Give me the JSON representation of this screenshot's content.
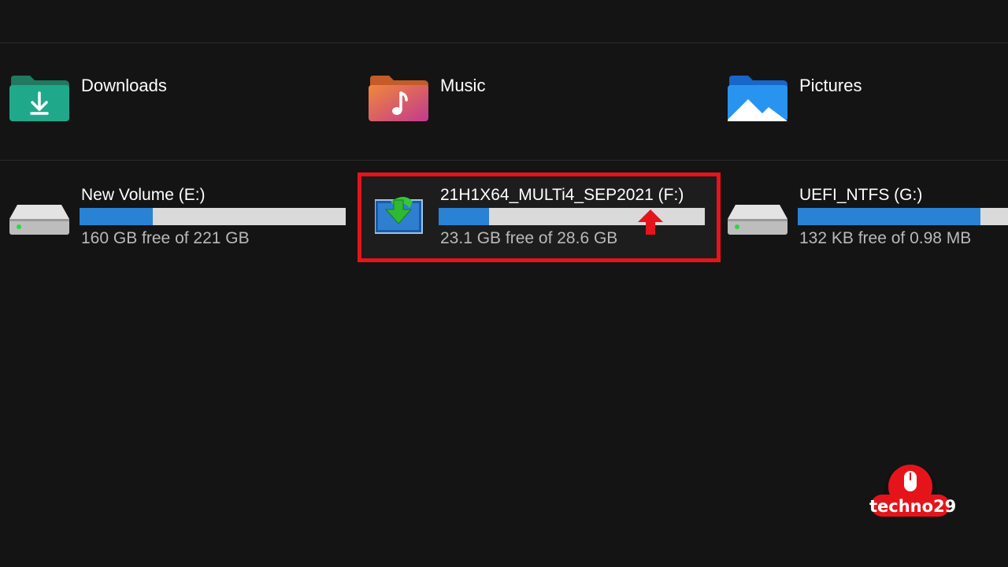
{
  "folders": [
    {
      "label": "Downloads",
      "icon": "downloads-folder-icon"
    },
    {
      "label": "Music",
      "icon": "music-folder-icon"
    },
    {
      "label": "Pictures",
      "icon": "pictures-folder-icon"
    }
  ],
  "drives": [
    {
      "name": "New Volume (E:)",
      "free_text": "160 GB free of 221 GB",
      "used_fraction": 0.276,
      "icon": "hard-drive-icon"
    },
    {
      "name": "21H1X64_MULTi4_SEP2021 (F:)",
      "free_text": "23.1 GB free of 28.6 GB",
      "used_fraction": 0.19,
      "icon": "usb-install-drive-icon",
      "highlighted": true
    },
    {
      "name": "UEFI_NTFS (G:)",
      "free_text": "132 KB free of 0.98 MB",
      "used_fraction": 0.87,
      "icon": "hard-drive-icon"
    }
  ],
  "annotation": {
    "icon": "red-arrow-up-icon",
    "color": "#e5141b"
  },
  "watermark": {
    "text": "techno29",
    "icon": "mouse-icon"
  },
  "colors": {
    "background": "#141414",
    "bar_fill": "#2a82d4",
    "bar_track": "#dadada",
    "highlight": "#e5141b"
  }
}
